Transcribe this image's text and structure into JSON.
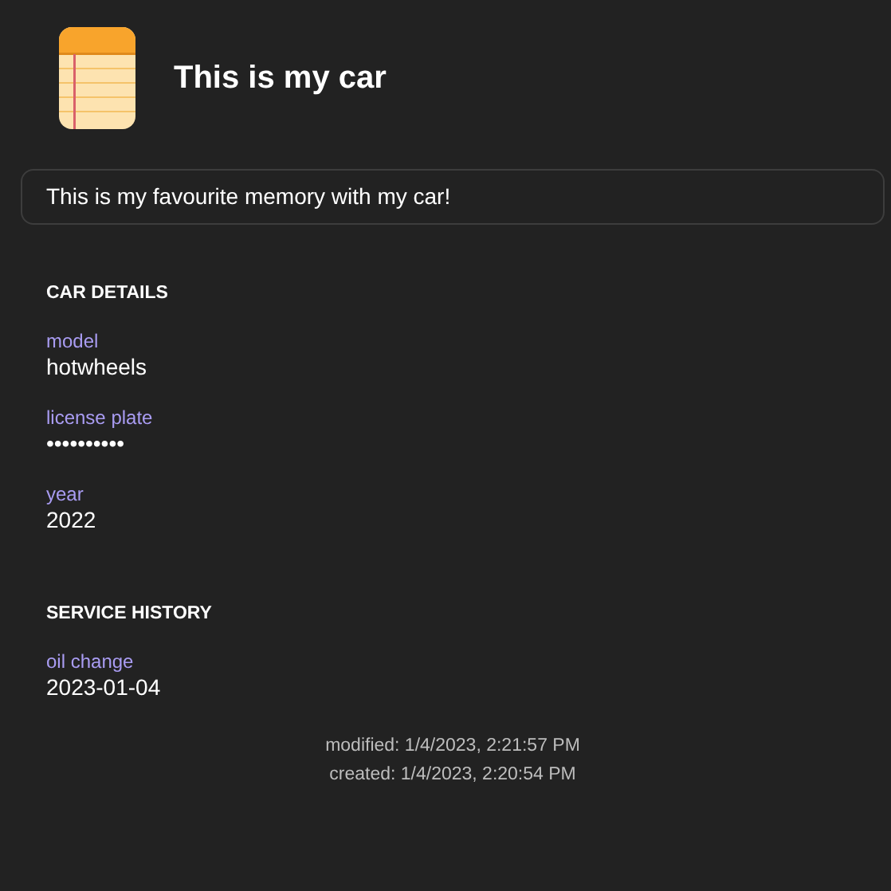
{
  "title": "This is my car",
  "note": "This is my favourite memory with my car!",
  "sections": [
    {
      "heading": "CAR DETAILS",
      "fields": [
        {
          "label": "model",
          "value": "hotwheels"
        },
        {
          "label": "license plate",
          "value": "••••••••••"
        },
        {
          "label": "year",
          "value": "2022"
        }
      ]
    },
    {
      "heading": "SERVICE HISTORY",
      "fields": [
        {
          "label": "oil change",
          "value": "2023-01-04"
        }
      ]
    }
  ],
  "footer": [
    "modified: 1/4/2023, 2:21:57 PM",
    "created: 1/4/2023, 2:20:54 PM"
  ]
}
